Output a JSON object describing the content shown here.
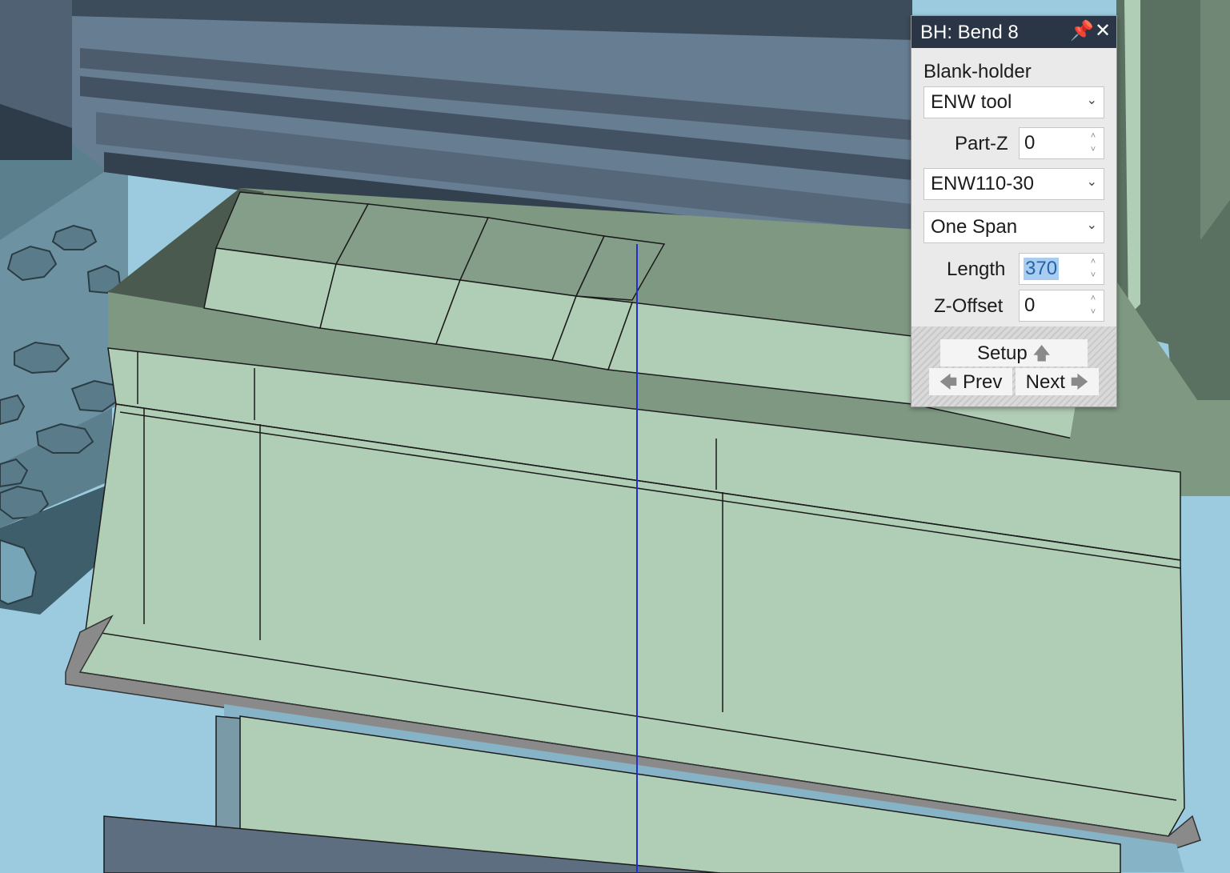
{
  "panel": {
    "title": "BH: Bend 8",
    "pin_icon": "pin-icon",
    "close_icon": "close-icon",
    "section_label": "Blank-holder",
    "tool_select": "ENW tool",
    "part_z": {
      "label": "Part-Z",
      "value": "0"
    },
    "tool_type_select": "ENW110-30",
    "span_select": "One Span",
    "length": {
      "label": "Length",
      "value": "370"
    },
    "z_offset": {
      "label": "Z-Offset",
      "value": "0"
    },
    "setup_button": "Setup",
    "prev_button": "Prev",
    "next_button": "Next"
  },
  "colors": {
    "accent_title_bar": "#2a3646",
    "model_face_light": "#b0cdb5",
    "model_face_dark": "#7e9882",
    "tool_grey": "#5d6e80",
    "selection": "#a9cdf0",
    "center_line": "#1f2fd0"
  }
}
